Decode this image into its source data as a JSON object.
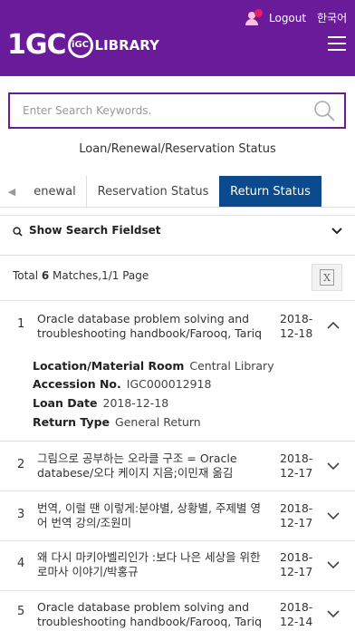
{
  "header": {
    "logout_label": "Logout",
    "language_label": "한국어",
    "logo_prefix": "1GC",
    "logo_mark": "iGC",
    "logo_suffix": "LIBRARY",
    "colors": {
      "brand": "#6a1b9a",
      "accent_tab": "#0b4a8c"
    }
  },
  "search": {
    "placeholder": "Enter Search Keywords."
  },
  "page_title": "Loan/Renewal/Reservation Status",
  "tabs": [
    {
      "label": "enewal",
      "active": false
    },
    {
      "label": "Reservation Status",
      "active": false
    },
    {
      "label": "Return Status",
      "active": true
    }
  ],
  "fieldset_toggle_label": "Show Search Fieldset",
  "results": {
    "prefix": "Total ",
    "count": "6",
    "suffix": " Matches,1/1 Page"
  },
  "items": [
    {
      "num": "1",
      "title": "Oracle database problem solving and troubleshooting handbook/Farooq, Tariq",
      "date": "2018-12-18",
      "date_lines": [
        "2018-",
        "12-18"
      ],
      "expanded": true,
      "details": [
        {
          "key": "Location/Material Room",
          "value": "Central Library"
        },
        {
          "key": "Accession No.",
          "value": "IGC000012918"
        },
        {
          "key": "Loan Date",
          "value": "2018-12-18"
        },
        {
          "key": "Return Type",
          "value": "General Return"
        }
      ]
    },
    {
      "num": "2",
      "title": "그림으로 공부하는 오라클 구조 = Oracle databese/오다 케이지 지음;이민재 옮김",
      "date_lines": [
        "2018-",
        "12-17"
      ]
    },
    {
      "num": "3",
      "title": "번역, 이럴 땐 이렇게:분야별, 상황별, 주제별 영어 번역 강의/조원미",
      "date_lines": [
        "2018-",
        "12-17"
      ]
    },
    {
      "num": "4",
      "title": "왜 다시 마키아벨리인가 :보다 나은 세상을 위한 로마사 이야기/박홍규",
      "date_lines": [
        "2018-",
        "12-17"
      ]
    },
    {
      "num": "5",
      "title": "Oracle database problem solving and troubleshooting handbook/Farooq, Tariq",
      "date_lines": [
        "2018-",
        "12-14"
      ]
    }
  ]
}
